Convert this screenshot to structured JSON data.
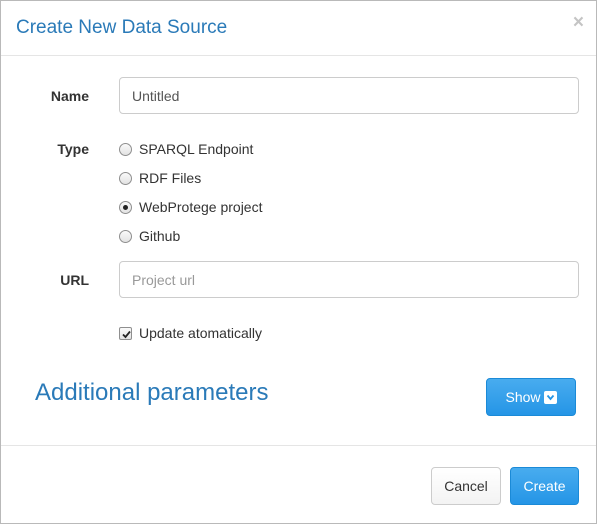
{
  "dialog": {
    "title": "Create New Data Source",
    "close_symbol": "×",
    "close_icon": "close-icon"
  },
  "form": {
    "name_label": "Name",
    "name_value": "Untitled",
    "type_label": "Type",
    "type_options": [
      {
        "label": "SPARQL Endpoint",
        "checked": false
      },
      {
        "label": "RDF Files",
        "checked": false
      },
      {
        "label": "WebProtege project",
        "checked": true
      },
      {
        "label": "Github",
        "checked": false
      }
    ],
    "url_label": "URL",
    "url_placeholder": "Project url",
    "url_value": "",
    "auto_update_label": "Update atomatically",
    "auto_update_checked": true
  },
  "additional": {
    "heading": "Additional parameters",
    "show_label": "Show",
    "show_icon": "chevron-down-icon"
  },
  "footer": {
    "cancel_label": "Cancel",
    "create_label": "Create"
  },
  "colors": {
    "title": "#2a7ab8",
    "primary_button": "#2595e6",
    "border": "#cccccc"
  }
}
